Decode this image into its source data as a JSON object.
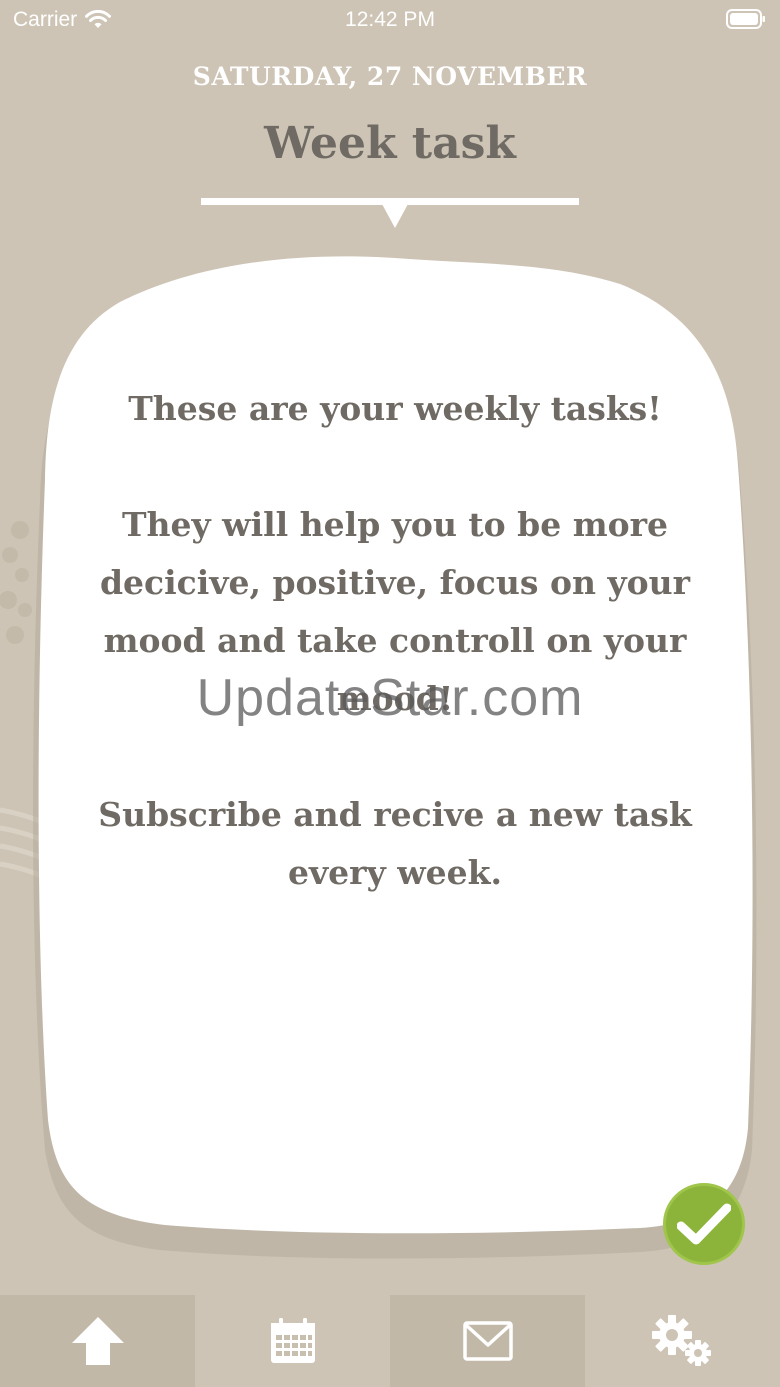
{
  "status_bar": {
    "carrier": "Carrier",
    "time": "12:42 PM"
  },
  "header": {
    "date": "SATURDAY, 27 NOVEMBER",
    "title": "Week task"
  },
  "card": {
    "line1": "These are your weekly tasks!",
    "para2": [
      "They will help you to be more",
      "decicive, positive, focus on your",
      "mood and take controll on your",
      "mood!"
    ],
    "para3": [
      "Subscribe and recive a new task",
      "every week."
    ]
  },
  "watermark": "UpdateStar.com",
  "tab_bar": {
    "tabs": [
      {
        "icon": "home-arrow-icon"
      },
      {
        "icon": "calendar-icon"
      },
      {
        "icon": "mail-icon"
      },
      {
        "icon": "gears-icon"
      }
    ]
  },
  "colors": {
    "background": "#cdc4b5",
    "text": "#6f6b64",
    "accent_green": "#8cb43a",
    "card": "#ffffff"
  }
}
